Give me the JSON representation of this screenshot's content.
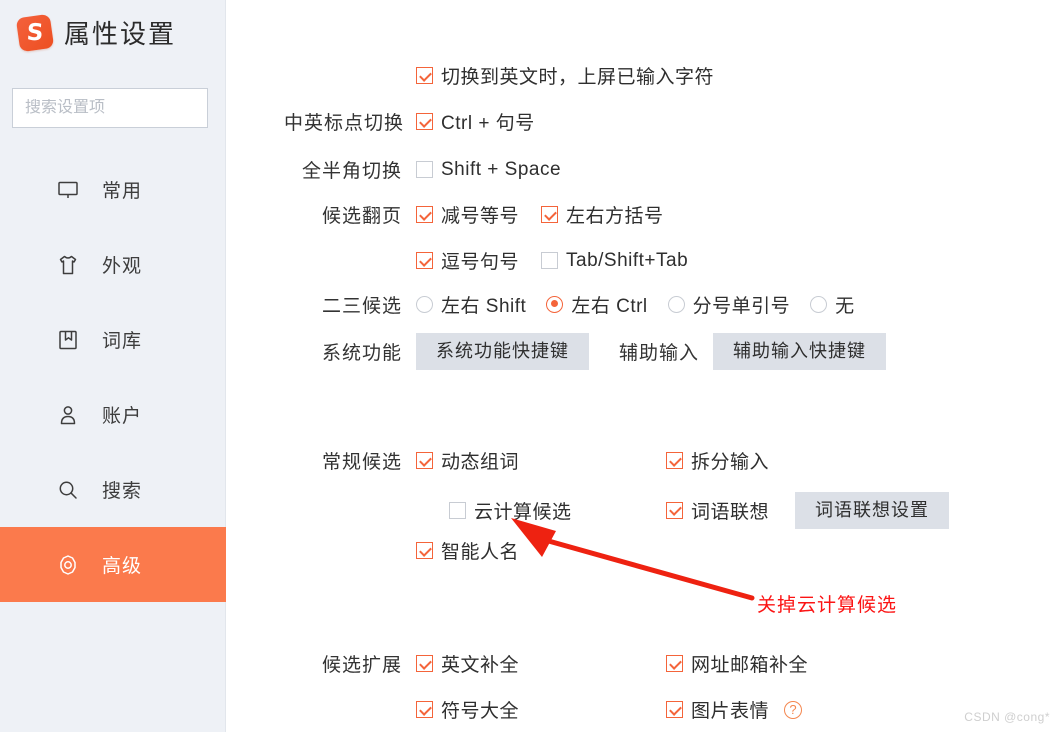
{
  "window": {
    "title": "属性设置",
    "logo_icon": "sogou-logo-icon",
    "help_label": "?",
    "minimize_label": "−"
  },
  "sidebar": {
    "search": {
      "placeholder": "搜索设置项",
      "value": "",
      "icon": "search-icon"
    },
    "items": [
      {
        "label": "常用",
        "icon": "monitor-icon",
        "active": false
      },
      {
        "label": "外观",
        "icon": "tshirt-icon",
        "active": false
      },
      {
        "label": "词库",
        "icon": "dictionary-icon",
        "active": false
      },
      {
        "label": "账户",
        "icon": "user-icon",
        "active": false
      },
      {
        "label": "搜索",
        "icon": "search-icon",
        "active": false
      },
      {
        "label": "高级",
        "icon": "gear-icon",
        "active": true
      }
    ]
  },
  "main": {
    "switch_english": {
      "label": "切换到英文时，上屏已输入字符",
      "checked": true
    },
    "punct_switch": {
      "label": "中英标点切换",
      "option": {
        "label": "Ctrl + 句号",
        "checked": true
      }
    },
    "width_switch": {
      "label": "全半角切换",
      "option": {
        "label": "Shift + Space",
        "checked": false
      }
    },
    "page_turn": {
      "label": "候选翻页",
      "options": [
        {
          "label": "减号等号",
          "checked": true
        },
        {
          "label": "左右方括号",
          "checked": true
        },
        {
          "label": "逗号句号",
          "checked": true
        },
        {
          "label": "Tab/Shift+Tab",
          "checked": false
        }
      ]
    },
    "second_third": {
      "label": "二三候选",
      "options": [
        {
          "label": "左右 Shift",
          "selected": false
        },
        {
          "label": "左右 Ctrl",
          "selected": true
        },
        {
          "label": "分号单引号",
          "selected": false
        },
        {
          "label": "无",
          "selected": false
        }
      ]
    },
    "system_function": {
      "label": "系统功能",
      "button": "系统功能快捷键"
    },
    "assist_input": {
      "label": "辅助输入",
      "button": "辅助输入快捷键"
    },
    "general_candidates": {
      "label": "常规候选",
      "options": [
        {
          "label": "动态组词",
          "checked": true
        },
        {
          "label": "拆分输入",
          "checked": true
        },
        {
          "label": "云计算候选",
          "checked": false
        },
        {
          "label": "词语联想",
          "checked": true
        },
        {
          "label": "智能人名",
          "checked": true
        }
      ],
      "button": "词语联想设置"
    },
    "candidate_extension": {
      "label": "候选扩展",
      "options": [
        {
          "label": "英文补全",
          "checked": true
        },
        {
          "label": "网址邮箱补全",
          "checked": true
        },
        {
          "label": "符号大全",
          "checked": true
        },
        {
          "label": "图片表情",
          "checked": true,
          "help_icon": "question-circle-icon"
        }
      ]
    }
  },
  "annotation": {
    "text": "关掉云计算候选",
    "color": "#fb1414",
    "arrow": "red-arrow-icon"
  },
  "watermark": "CSDN @cong*",
  "colors": {
    "accent": "#fb7a4c",
    "checkbox_on": "#f4643a",
    "sidebar_bg": "#eef1f6",
    "button_bg": "#dce0e7",
    "annotation_red": "#fb1414"
  }
}
